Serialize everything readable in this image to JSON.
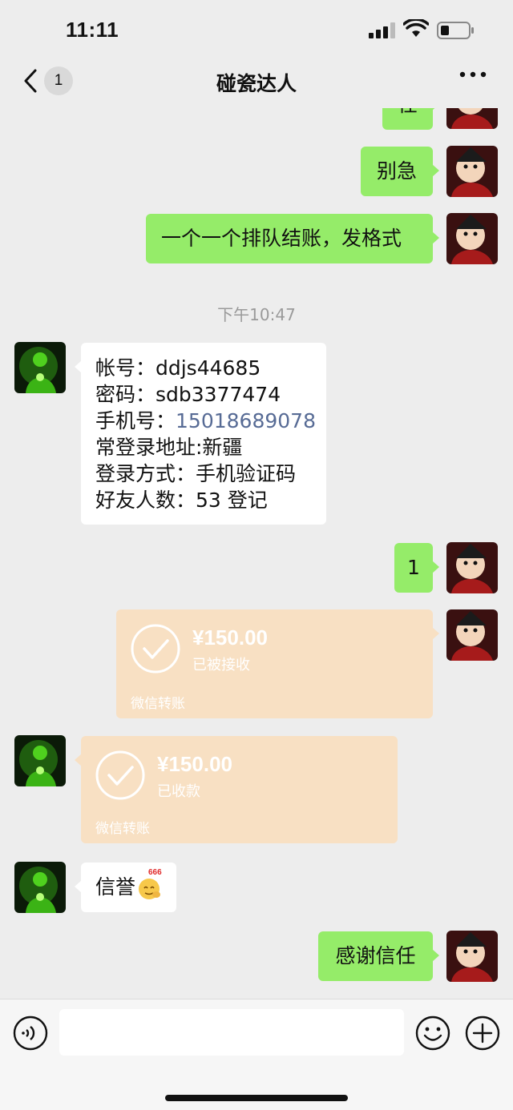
{
  "status_bar": {
    "time": "11:11"
  },
  "header": {
    "unread_count": "1",
    "title": "碰瓷达人"
  },
  "messages": {
    "partial_top": "任",
    "m1": "别急",
    "m2": "一个一个排队结账，发格式",
    "timestamp": "下午10:47",
    "account": {
      "l1": "帐号：ddjs44685",
      "l2": "密码：sdb3377474",
      "l3_prefix": "手机号：",
      "l3_phone": "15018689078",
      "l4": "常登录地址:新疆",
      "l5": "登录方式：手机验证码",
      "l6": "好友人数：53  登记"
    },
    "m3": "1",
    "transfer_sent": {
      "amount": "¥150.00",
      "status": "已被接收",
      "label": "微信转账"
    },
    "transfer_recv": {
      "amount": "¥150.00",
      "status": "已收款",
      "label": "微信转账"
    },
    "m4": "信誉",
    "m4_sticker": "666",
    "m5": "感谢信任"
  },
  "colors": {
    "outgoing_bubble": "#95ec69",
    "incoming_bubble": "#ffffff",
    "transfer_bubble": "#f8e0c3",
    "link": "#576b95"
  }
}
